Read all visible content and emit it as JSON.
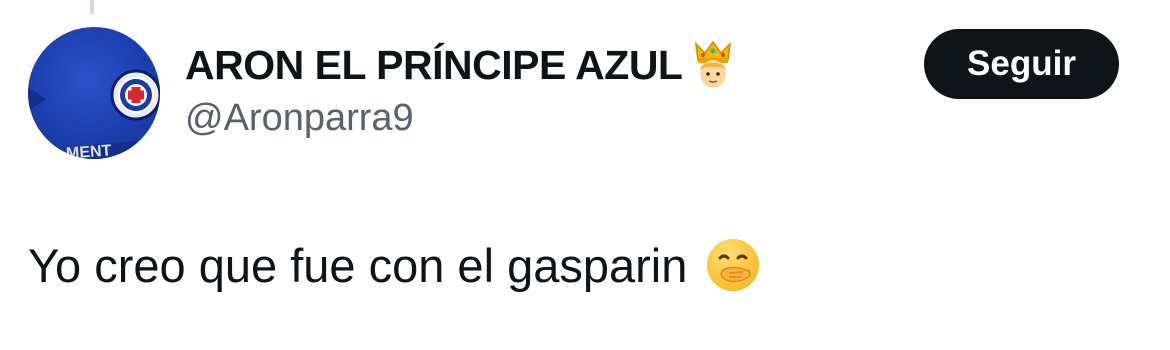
{
  "author": {
    "display_name": "ARON EL PRÍNCIPE AZUL",
    "handle": "@Aronparra9",
    "name_emoji": "crown-person-icon",
    "avatar": "cruz-azul-jersey-avatar",
    "avatar_text": "MENT"
  },
  "actions": {
    "follow_label": "Seguir"
  },
  "tweet": {
    "text": "Yo creo que fue con el gasparin",
    "emoji": "face-with-hand-over-mouth-icon"
  },
  "colors": {
    "text": "#0f1419",
    "secondary": "#536471",
    "button_bg": "#0f1419",
    "avatar_blue": "#1c3fae"
  }
}
